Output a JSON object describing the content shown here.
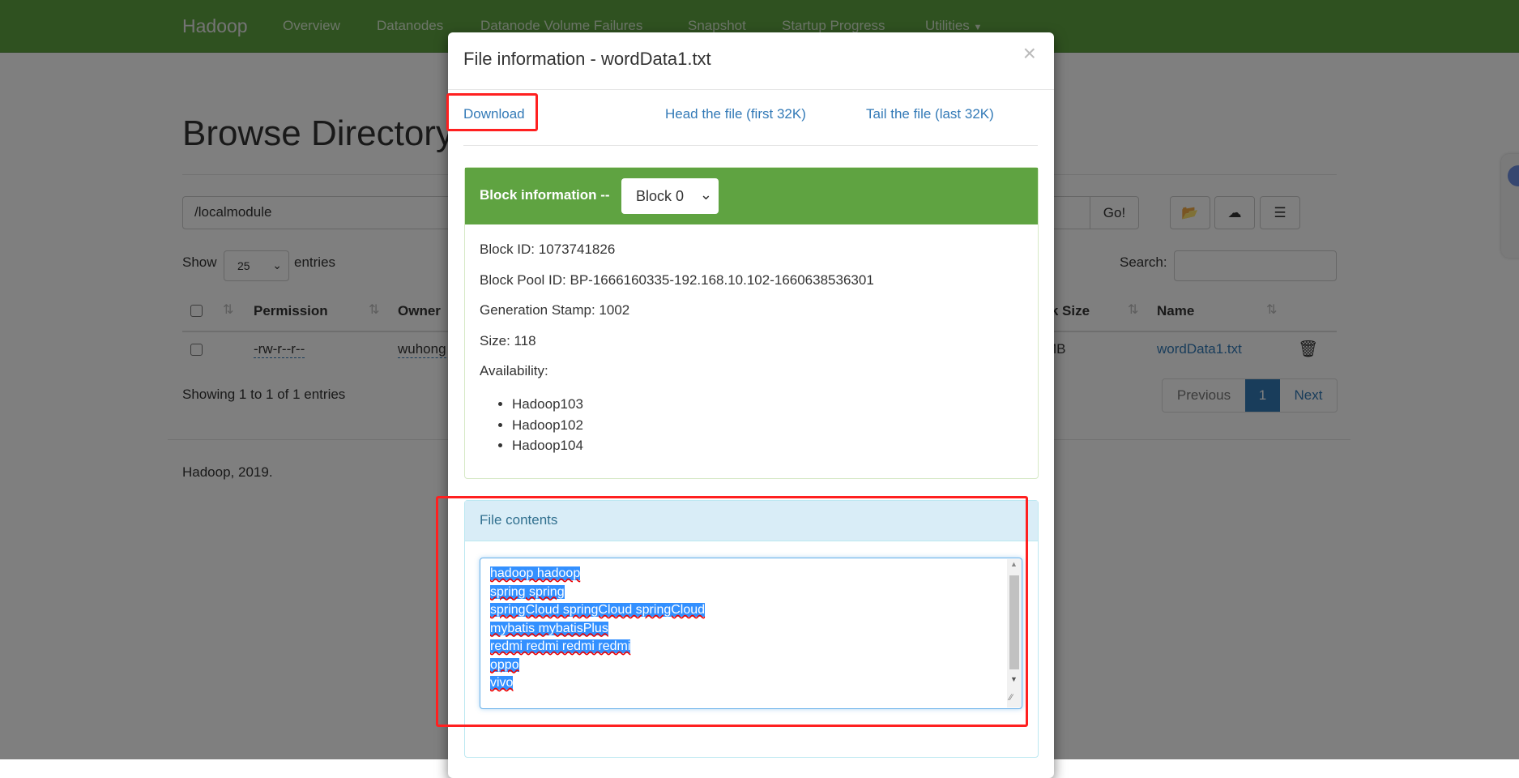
{
  "navbar": {
    "brand": "Hadoop",
    "items": [
      "Overview",
      "Datanodes",
      "Datanode Volume Failures",
      "Snapshot",
      "Startup Progress",
      "Utilities"
    ],
    "color": "#5fa341"
  },
  "browse": {
    "title": "Browse Directory",
    "path": "/localmodule",
    "go_label": "Go!",
    "show_label": "Show",
    "entries_label": "entries",
    "page_size": "25",
    "search_label": "Search:",
    "columns": [
      "Permission",
      "Owner",
      "Block Size",
      "Name"
    ],
    "rows": [
      {
        "permission": "-rw-r--r--",
        "owner": "wuhong",
        "block_size": "MB",
        "name": "wordData1.txt"
      }
    ],
    "summary": "Showing 1 to 1 of 1 entries",
    "pagination": {
      "previous": "Previous",
      "current": "1",
      "next": "Next"
    },
    "footer": "Hadoop, 2019."
  },
  "modal": {
    "title": "File information - wordData1.txt",
    "close": "×",
    "links": {
      "download": "Download",
      "head": "Head the file (first 32K)",
      "tail": "Tail the file (last 32K)"
    },
    "block": {
      "heading": "Block information --",
      "selected": "Block 0",
      "id": "Block ID: 1073741826",
      "pool": "Block Pool ID: BP-1666160335-192.168.10.102-1660638536301",
      "gen": "Generation Stamp: 1002",
      "size": "Size: 118",
      "availability": "Availability:",
      "nodes": [
        "Hadoop103",
        "Hadoop102",
        "Hadoop104"
      ]
    },
    "contents": {
      "heading": "File contents",
      "text": "hadoop hadoop\nspring spring\nspringCloud springCloud springCloud\nmybatis mybatisPlus\nredmi redmi redmi redmi\noppo\nvivo"
    }
  }
}
